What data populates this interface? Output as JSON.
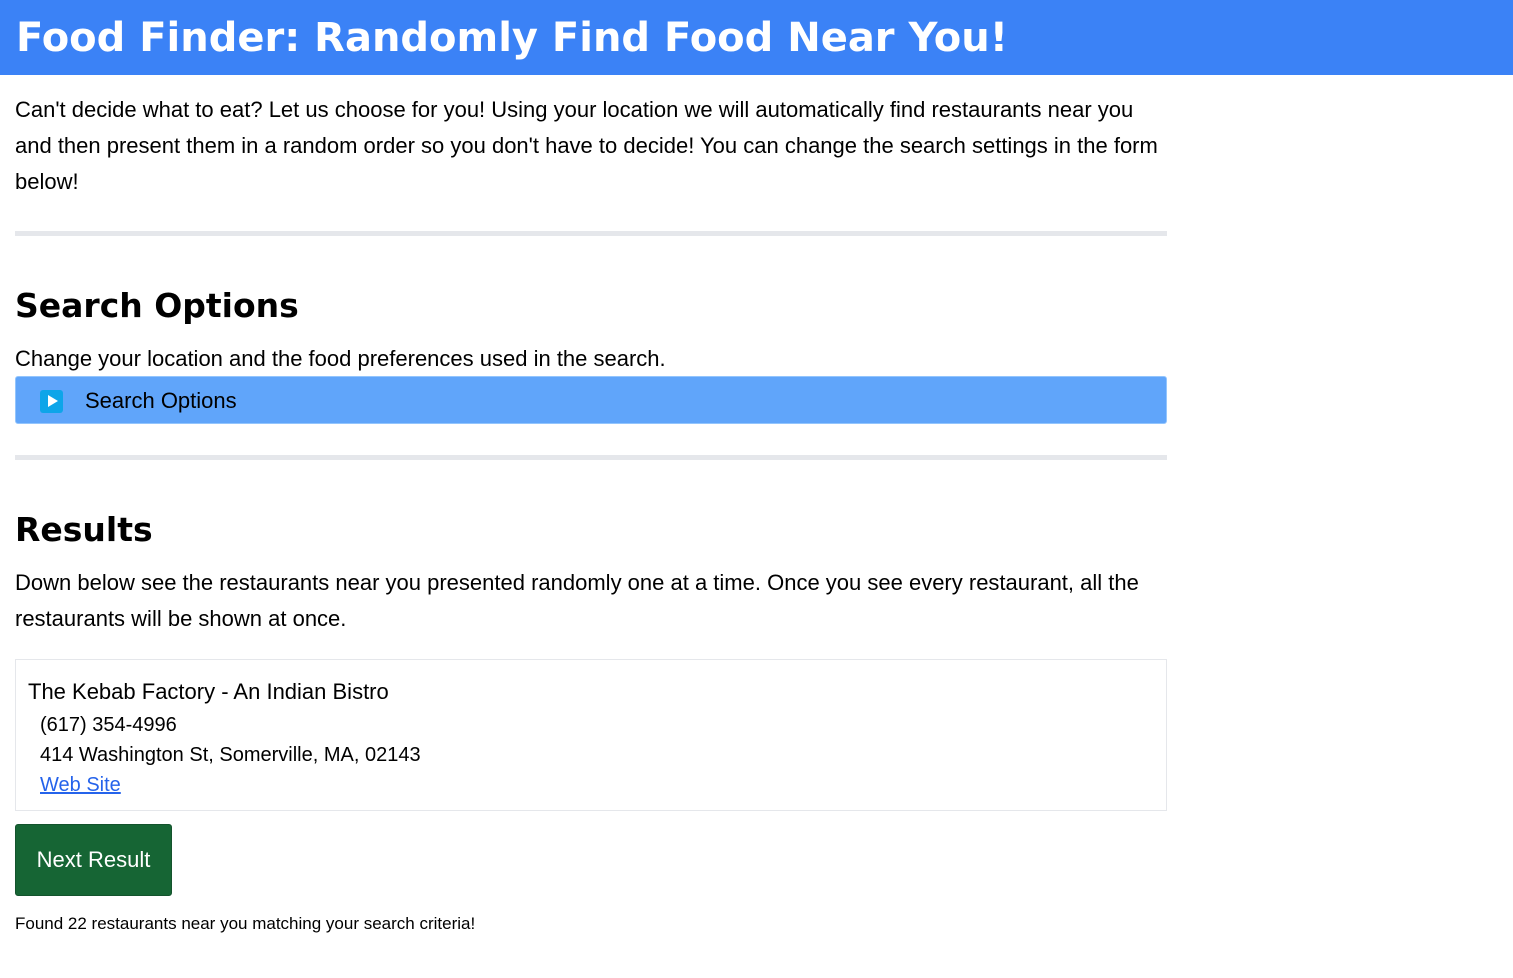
{
  "header": {
    "title": "Food Finder: Randomly Find Food Near You!",
    "background_color": "#3b82f6"
  },
  "intro": {
    "text": "Can't decide what to eat? Let us choose for you! Using your location we will automatically find restaurants near you and then present them in a random order so you don't have to decide! You can change the search settings in the form below!"
  },
  "search_options": {
    "title": "Search Options",
    "description": "Change your location and the food preferences used in the search.",
    "toggle_label": "Search Options",
    "toggle_icon": "play-icon",
    "toggle_color": "#60a5fa"
  },
  "results": {
    "title": "Results",
    "description": "Down below see the restaurants near you presented randomly one at a time. Once you see every restaurant, all the restaurants will be shown at once.",
    "current": {
      "name": "The Kebab Factory - An Indian Bistro",
      "phone": "(617) 354-4996",
      "address": "414 Washington St, Somerville, MA, 02143",
      "website_label": "Web Site"
    },
    "next_button_label": "Next Result",
    "next_button_color": "#166534",
    "found_message": "Found 22 restaurants near you matching your search criteria!"
  }
}
